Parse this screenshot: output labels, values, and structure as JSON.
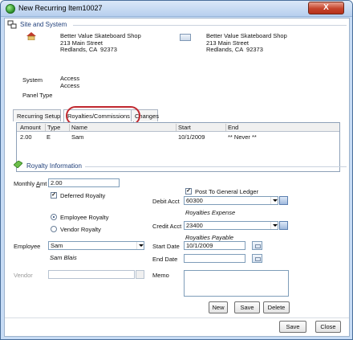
{
  "window": {
    "title": "New Recurring Item10027",
    "close_label": "X"
  },
  "site_system": {
    "header": "Site and System",
    "site_name": "Better Value Skateboard Shop",
    "site_address1": "213 Main Street",
    "site_city": "Redlands, CA  92373",
    "billing_name": "Better Value Skateboard Shop",
    "billing_address1": "213 Main Street",
    "billing_city": "Redlands, CA  92373",
    "system_label": "System",
    "system_value1": "Access",
    "system_value2": "Access",
    "panel_type_label": "Panel Type",
    "panel_type_value": ""
  },
  "tabs": {
    "recurring_setup": "Recurring Setup",
    "royalties": "Royalties/Commissions",
    "changes": "Changes"
  },
  "grid": {
    "columns": [
      "Amount",
      "Type",
      "Name",
      "Start",
      "End"
    ],
    "rows": [
      [
        "2.00",
        "E",
        "Sam",
        "10/1/2009",
        "** Never **"
      ]
    ]
  },
  "royalty": {
    "header": "Royalty Information",
    "monthly_amt_label_pre": "Monthly ",
    "monthly_amt_label_ul": "A",
    "monthly_amt_label_post": "mt",
    "monthly_amt_value": "2.00",
    "deferred_label": "Deferred Royalty",
    "deferred_checked": "✓",
    "employee_royalty_label": "Employee Royalty",
    "vendor_royalty_label": "Vendor Royalty",
    "employee_label": "Employee",
    "employee_value": "Sam",
    "employee_fullname": "Sam Blais",
    "vendor_label": "Vendor",
    "vendor_value": "",
    "post_gl_label": "Post To General Ledger",
    "post_gl_checked": "✓",
    "debit_acct_label": "Debit Acct",
    "debit_acct_value": "60300",
    "debit_acct_desc": "Royalties Expense",
    "credit_acct_label": "Credit Acct",
    "credit_acct_value": "23400",
    "credit_acct_desc": "Royalties Payable",
    "start_date_label": "Start Date",
    "start_date_value": "10/1/2009",
    "end_date_label": "End Date",
    "end_date_value": "",
    "memo_label": "Memo"
  },
  "buttons": {
    "new": "New",
    "save_inner": "Save",
    "delete": "Delete",
    "save": "Save",
    "close": "Close"
  },
  "colors": {
    "section_header": "#1f3f7a",
    "tab_highlight": "#c0282f",
    "window_frame": "#c7dcf5"
  }
}
